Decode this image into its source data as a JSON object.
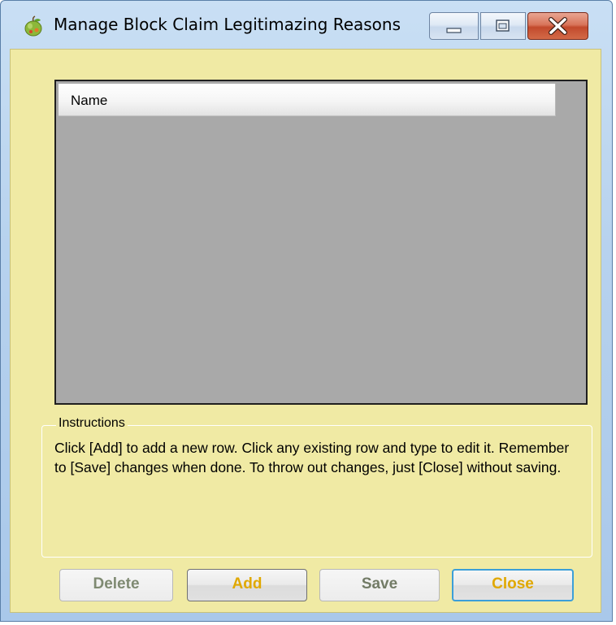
{
  "window": {
    "title": "Manage Block Claim Legitimazing Reasons",
    "app_icon": "apple-icon",
    "caption_buttons": {
      "minimize_icon": "minimize-icon",
      "maximize_icon": "maximize-icon",
      "close_icon": "close-icon"
    }
  },
  "grid": {
    "columns": [
      "Name"
    ],
    "rows": []
  },
  "instructions": {
    "legend": "Instructions",
    "text": "Click [Add] to add a new row.  Click any existing row and type to edit it.  Remember to [Save] changes when done.  To throw out changes, just [Close] without saving."
  },
  "buttons": {
    "delete_label": "Delete",
    "add_label": "Add",
    "save_label": "Save",
    "close_label": "Close"
  },
  "colors": {
    "dialog_background": "#f0eaa4",
    "grid_background": "#a9a9a9",
    "accent_button_text": "#e0a800",
    "focus_border": "#3c9fd8",
    "close_caption_button": "#c24a2c"
  }
}
